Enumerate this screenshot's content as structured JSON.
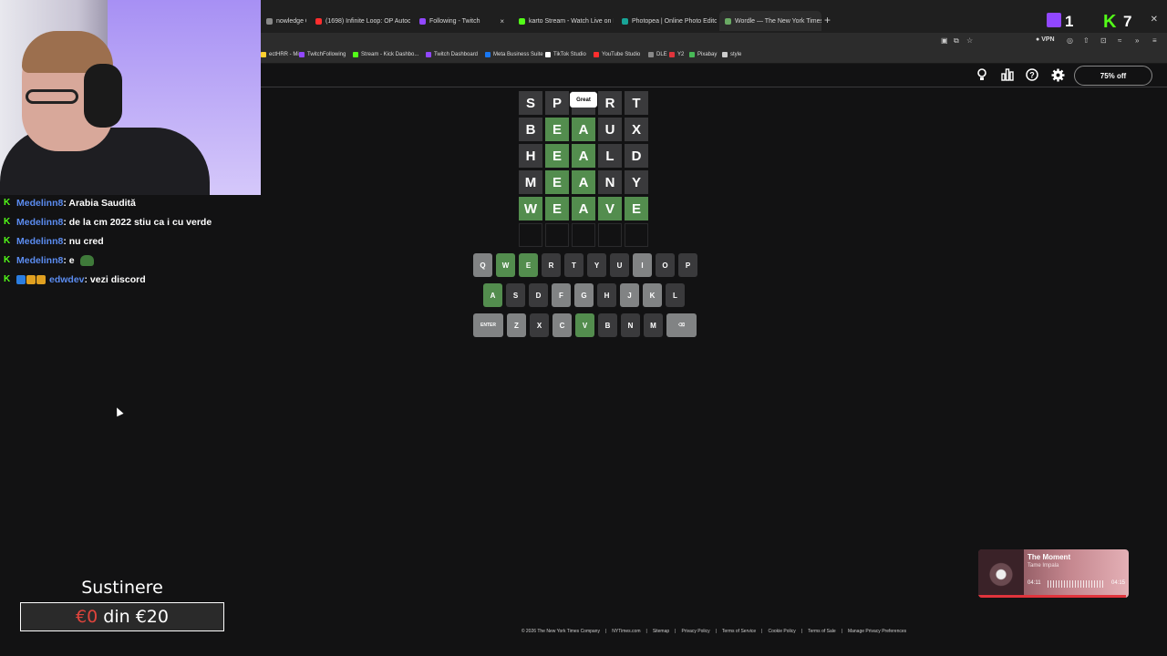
{
  "browser": {
    "tabs": [
      {
        "label": "nowledge Quiz",
        "icon": "blank-icon",
        "color": "#888888"
      },
      {
        "label": "(1698) Infinite Loop: OP Autoca",
        "icon": "youtube-icon",
        "color": "#ff2e2e"
      },
      {
        "label": "Following - Twitch",
        "icon": "twitch-icon",
        "color": "#9147ff"
      },
      {
        "label": "karto Stream - Watch Live on K",
        "icon": "kick-icon",
        "color": "#53fc18"
      },
      {
        "label": "Photopea | Online Photo Editor",
        "icon": "photopea-icon",
        "color": "#18a497"
      },
      {
        "label": "Wordle — The New York Times",
        "icon": "wordle-icon",
        "color": "#6aaa64"
      }
    ],
    "new_tab": "+",
    "vpn_label": "VPN",
    "bookmarks": [
      {
        "label": "ectHRR - Miro",
        "color": "#ffd02f"
      },
      {
        "label": "TwitchFollowing",
        "color": "#9147ff"
      },
      {
        "label": "Stream - Kick Dashbo...",
        "color": "#53fc18"
      },
      {
        "label": "Twitch Dashboard",
        "color": "#9147ff"
      },
      {
        "label": "Meta Business Suite",
        "color": "#1877f2"
      },
      {
        "label": "TikTok Studio",
        "color": "#ffffff"
      },
      {
        "label": "YouTube Studio",
        "color": "#ff2e2e"
      },
      {
        "label": "DLE",
        "color": "#888888"
      },
      {
        "label": "Y2",
        "color": "#e0343c"
      },
      {
        "label": "Pixabay",
        "color": "#48b957"
      },
      {
        "label": "style",
        "color": "#cccccc"
      }
    ]
  },
  "overlay_top": {
    "twitch_count": "1",
    "kick_count": "7"
  },
  "wordle": {
    "subscribe_label": "75% off",
    "toast": "Great",
    "rows": [
      [
        {
          "l": "S",
          "s": "absent"
        },
        {
          "l": "P",
          "s": "absent"
        },
        {
          "l": "",
          "s": "absent"
        },
        {
          "l": "R",
          "s": "absent"
        },
        {
          "l": "T",
          "s": "absent"
        }
      ],
      [
        {
          "l": "B",
          "s": "absent"
        },
        {
          "l": "E",
          "s": "correct"
        },
        {
          "l": "A",
          "s": "correct"
        },
        {
          "l": "U",
          "s": "absent"
        },
        {
          "l": "X",
          "s": "absent"
        }
      ],
      [
        {
          "l": "H",
          "s": "absent"
        },
        {
          "l": "E",
          "s": "correct"
        },
        {
          "l": "A",
          "s": "correct"
        },
        {
          "l": "L",
          "s": "absent"
        },
        {
          "l": "D",
          "s": "absent"
        }
      ],
      [
        {
          "l": "M",
          "s": "absent"
        },
        {
          "l": "E",
          "s": "correct"
        },
        {
          "l": "A",
          "s": "correct"
        },
        {
          "l": "N",
          "s": "absent"
        },
        {
          "l": "Y",
          "s": "absent"
        }
      ],
      [
        {
          "l": "W",
          "s": "correct"
        },
        {
          "l": "E",
          "s": "correct"
        },
        {
          "l": "A",
          "s": "correct"
        },
        {
          "l": "V",
          "s": "correct"
        },
        {
          "l": "E",
          "s": "correct"
        }
      ],
      [
        {
          "l": "",
          "s": "empty"
        },
        {
          "l": "",
          "s": "empty"
        },
        {
          "l": "",
          "s": "empty"
        },
        {
          "l": "",
          "s": "empty"
        },
        {
          "l": "",
          "s": "empty"
        }
      ]
    ],
    "keyboard": [
      [
        {
          "k": "Q",
          "s": "unused"
        },
        {
          "k": "W",
          "s": "correct"
        },
        {
          "k": "E",
          "s": "correct"
        },
        {
          "k": "R",
          "s": "absent"
        },
        {
          "k": "T",
          "s": "absent"
        },
        {
          "k": "Y",
          "s": "absent"
        },
        {
          "k": "U",
          "s": "absent"
        },
        {
          "k": "I",
          "s": "unused"
        },
        {
          "k": "O",
          "s": "absent"
        },
        {
          "k": "P",
          "s": "absent"
        }
      ],
      [
        {
          "k": "A",
          "s": "correct"
        },
        {
          "k": "S",
          "s": "absent"
        },
        {
          "k": "D",
          "s": "absent"
        },
        {
          "k": "F",
          "s": "unused"
        },
        {
          "k": "G",
          "s": "unused"
        },
        {
          "k": "H",
          "s": "absent"
        },
        {
          "k": "J",
          "s": "unused"
        },
        {
          "k": "K",
          "s": "unused"
        },
        {
          "k": "L",
          "s": "absent"
        }
      ],
      [
        {
          "k": "ENTER",
          "s": "unused",
          "wide": true
        },
        {
          "k": "Z",
          "s": "unused"
        },
        {
          "k": "X",
          "s": "absent"
        },
        {
          "k": "C",
          "s": "unused"
        },
        {
          "k": "V",
          "s": "correct"
        },
        {
          "k": "B",
          "s": "absent"
        },
        {
          "k": "N",
          "s": "absent"
        },
        {
          "k": "M",
          "s": "absent"
        },
        {
          "k": "⌫",
          "s": "unused",
          "wide": true
        }
      ]
    ],
    "footer": [
      "© 2026 The New York Times Company",
      "NYTimes.com",
      "Sitemap",
      "Privacy Policy",
      "Terms of Service",
      "Cookie Policy",
      "Terms of Sale",
      "Manage Privacy Preferences"
    ]
  },
  "chat": [
    {
      "user": "Medelinn8",
      "text": ": Arabia Saudită",
      "extra_badges": []
    },
    {
      "user": "Medelinn8",
      "text": ": de la cm 2022 stiu ca i cu verde",
      "extra_badges": []
    },
    {
      "user": "Medelinn8",
      "text": ": nu cred",
      "extra_badges": []
    },
    {
      "user": "Medelinn8",
      "text": ": e",
      "extra_badges": [],
      "emote": "frog-emote"
    },
    {
      "user": "edwdev",
      "text": ": vezi discord",
      "extra_badges": [
        "#2b7de0",
        "#e0a020",
        "#e0a020"
      ]
    }
  ],
  "donation": {
    "title": "Sustinere",
    "current": "€0",
    "middle": " din ",
    "goal": "€20"
  },
  "music": {
    "title": "The Moment",
    "artist": "Tame Impala",
    "elapsed": "04:11",
    "duration": "04:15",
    "progress": 0.98
  }
}
